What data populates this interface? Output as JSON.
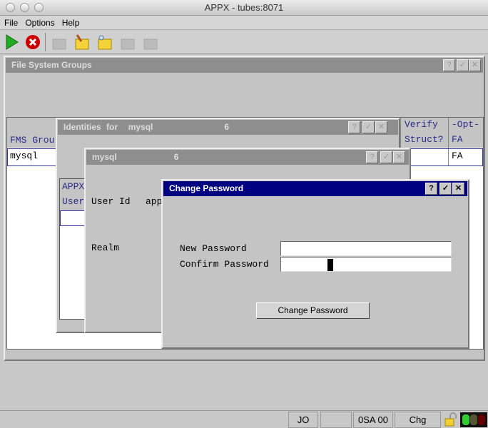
{
  "window": {
    "title": "APPX - tubes:8071"
  },
  "menu": [
    "File",
    "Options",
    "Help"
  ],
  "toolbar": [
    "run-icon",
    "cancel-icon",
    "new-icon",
    "edit-icon",
    "inquire-icon",
    "delete-icon",
    "approve-icon"
  ],
  "fsg": {
    "title": "File System Groups",
    "col1": "FMS Grou",
    "col2a": "Verify",
    "col2b": "Struct?",
    "col3a": "-Opt-",
    "col3b": "FA",
    "row_name": "mysql",
    "row_opt": "FA"
  },
  "identities": {
    "title": "Identities for",
    "name": "mysql",
    "num": "6",
    "list_h1": "APPX",
    "list_h2": "User"
  },
  "mysqlwin": {
    "title": "mysql",
    "num": "6",
    "userid_label": "User Id",
    "userid_value": "app",
    "realm_label": "Realm"
  },
  "change": {
    "title": "Change Password",
    "new_label": "New Password",
    "confirm_label": "Confirm Password",
    "new_value": "",
    "confirm_value": "",
    "button": "Change Password"
  },
  "status": {
    "s1": "JO",
    "s2": "",
    "s3": "0SA 00",
    "s4": "Chg"
  },
  "colors": {
    "active_title": "#000080",
    "inactive_title": "#8e8e8e"
  }
}
